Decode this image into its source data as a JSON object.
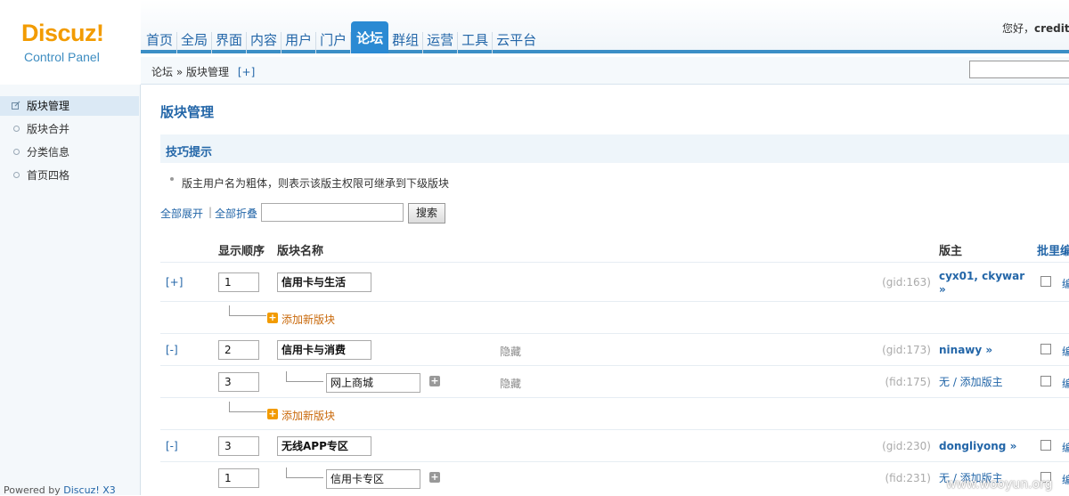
{
  "header": {
    "logo_word": "Discuz!",
    "logo_sub": "Control Panel",
    "greeting": "您好，",
    "username": "creditb",
    "nav": [
      {
        "label": "首页"
      },
      {
        "label": "全局"
      },
      {
        "label": "界面"
      },
      {
        "label": "内容"
      },
      {
        "label": "用户"
      },
      {
        "label": "门户"
      },
      {
        "label": "论坛",
        "active": true
      },
      {
        "label": "群组"
      },
      {
        "label": "运营"
      },
      {
        "label": "工具"
      },
      {
        "label": "云平台"
      }
    ]
  },
  "breadcrumb": {
    "root": "论坛",
    "sep": "»",
    "current": "版块管理",
    "plus": "[+]"
  },
  "sidebar": {
    "items": [
      {
        "label": "版块管理",
        "active": true
      },
      {
        "label": "版块合并"
      },
      {
        "label": "分类信息"
      },
      {
        "label": "首页四格"
      }
    ],
    "powered_prefix": "Powered by ",
    "powered_brand": "Discuz! X3"
  },
  "main": {
    "title": "版块管理",
    "tip_title": "技巧提示",
    "tip_text": "版主用户名为粗体，则表示该版主权限可继承到下级版块",
    "expand_all": "全部展开",
    "sep": "|",
    "collapse_all": "全部折叠",
    "search_button": "搜索",
    "table": {
      "headers": {
        "order": "显示顺序",
        "name": "版块名称",
        "moderators": "版主",
        "batch": "批里编"
      },
      "add_new": "添加新版块",
      "rows": [
        {
          "toggle": "[+]",
          "order": "1",
          "name": "信用卡与生活",
          "hidden": "",
          "gid": "(gid:163)",
          "mods": "cyx01, ckywar",
          "mods2": "»",
          "edit": "编"
        },
        {
          "toggle": "[-]",
          "order": "2",
          "name": "信用卡与消费",
          "hidden": "隐藏",
          "gid": "(gid:173)",
          "mods": "ninawy »",
          "edit": "编"
        },
        {
          "order": "3",
          "name": "网上商城",
          "hidden": "隐藏",
          "gid": "(fid:175)",
          "mods": "无 / 添加版主",
          "edit": "编"
        },
        {
          "toggle": "[-]",
          "order": "3",
          "name": "无线APP专区",
          "hidden": "",
          "gid": "(gid:230)",
          "mods": "dongliyong »",
          "edit": "编"
        },
        {
          "order": "1",
          "name": "信用卡专区",
          "hidden": "",
          "gid": "(fid:231)",
          "mods": "无 / 添加版主",
          "edit": "编"
        }
      ]
    }
  },
  "watermark": "www.wooyun.org"
}
